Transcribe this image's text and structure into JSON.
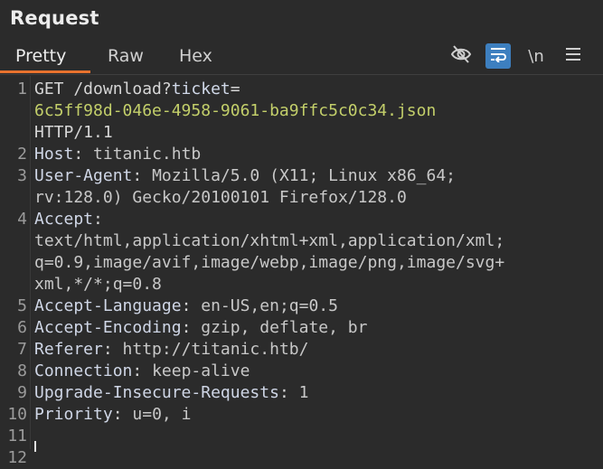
{
  "panel": {
    "title": "Request"
  },
  "tabs": [
    {
      "label": "Pretty",
      "active": true
    },
    {
      "label": "Raw",
      "active": false
    },
    {
      "label": "Hex",
      "active": false
    }
  ],
  "toolbar": {
    "hide_icon": "eye-off-icon",
    "wrap_icon": "word-wrap-icon",
    "newline_label": "\\n",
    "menu_icon": "hamburger-menu-icon",
    "accent_color": "#e8722e",
    "toggle_color": "#3d7fbf"
  },
  "request": {
    "line_numbers": [
      "1",
      "2",
      "3",
      "4",
      "5",
      "6",
      "7",
      "8",
      "9",
      "10",
      "11",
      "12"
    ],
    "line1": {
      "method_path": "GET /download?",
      "param_name": "ticket",
      "equals": "=",
      "param_value": "6c5ff98d-046e-4958-9061-ba9ffc5c0c34.json",
      "protocol": "HTTP/1.1"
    },
    "headers": [
      {
        "key": "Host",
        "sep": ": ",
        "value": "titanic.htb"
      },
      {
        "key": "User-Agent",
        "sep": ": ",
        "value": "Mozilla/5.0 (X11; Linux x86_64;",
        "value2": "rv:128.0) Gecko/20100101 Firefox/128.0"
      },
      {
        "key": "Accept",
        "sep": ":",
        "value": "text/html,application/xhtml+xml,application/xml;",
        "value2": "q=0.9,image/avif,image/webp,image/png,image/svg+",
        "value3": "xml,*/*;q=0.8"
      },
      {
        "key": "Accept-Language",
        "sep": ": ",
        "value": "en-US,en;q=0.5"
      },
      {
        "key": "Accept-Encoding",
        "sep": ": ",
        "value": "gzip, deflate, br"
      },
      {
        "key": "Referer",
        "sep": ": ",
        "value": "http://titanic.htb/"
      },
      {
        "key": "Connection",
        "sep": ": ",
        "value": "keep-alive"
      },
      {
        "key": "Upgrade-Insecure-Requests",
        "sep": ": ",
        "value": "1"
      },
      {
        "key": "Priority",
        "sep": ": ",
        "value": "u=0, i"
      }
    ]
  }
}
